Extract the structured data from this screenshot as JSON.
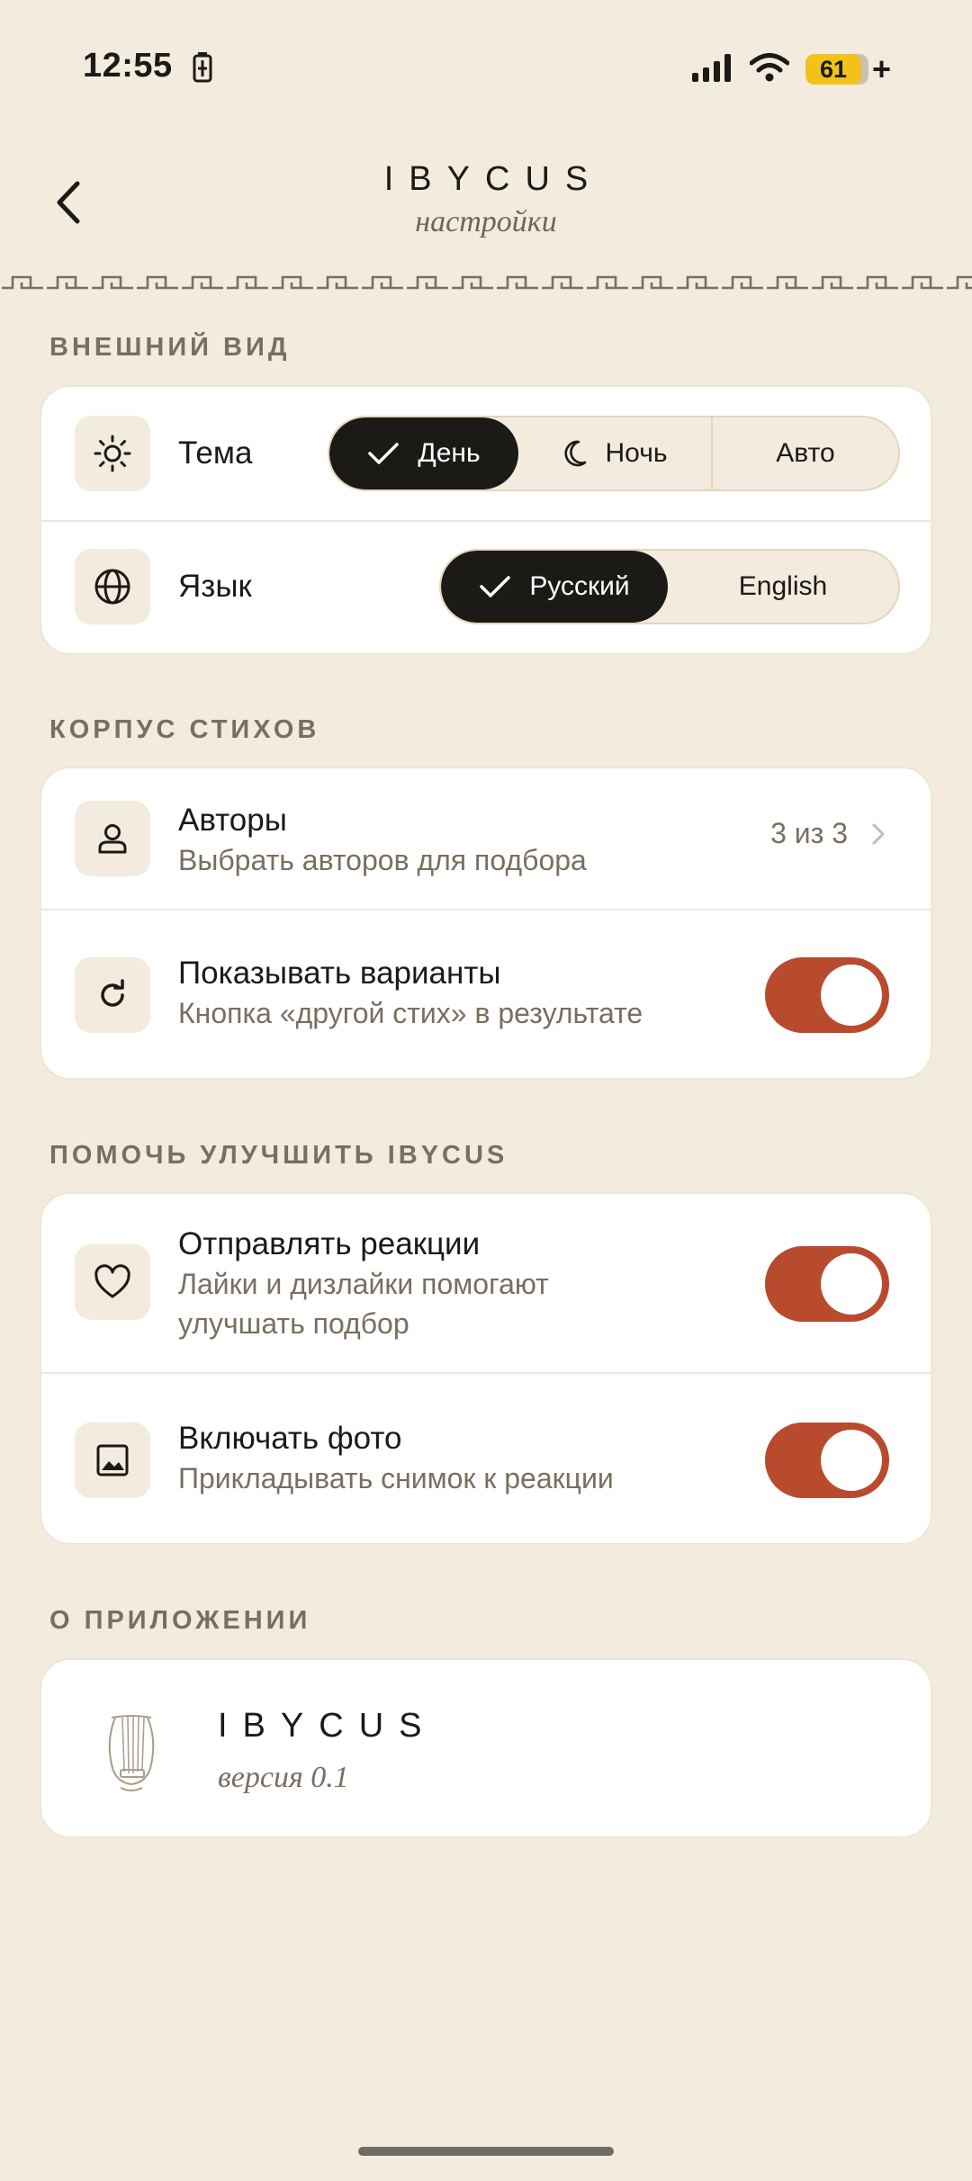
{
  "status_bar": {
    "time": "12:55",
    "battery": "61",
    "battery_suffix": "+"
  },
  "header": {
    "title": "IBYCUS",
    "subtitle": "настройки"
  },
  "sections": {
    "appearance": {
      "label": "ВНЕШНИЙ ВИД",
      "theme": {
        "label": "Тема",
        "options": [
          "День",
          "Ночь",
          "Авто"
        ],
        "selected": "День"
      },
      "language": {
        "label": "Язык",
        "options": [
          "Русский",
          "English"
        ],
        "selected": "Русский"
      }
    },
    "corpus": {
      "label": "КОРПУС СТИХОВ",
      "authors": {
        "title": "Авторы",
        "subtitle": "Выбрать авторов для подбора",
        "count": "3 из 3"
      },
      "variants": {
        "title": "Показывать варианты",
        "subtitle": "Кнопка «другой стих» в результате",
        "enabled": true
      }
    },
    "improve": {
      "label": "ПОМОЧЬ УЛУЧШИТЬ IBYCUS",
      "reactions": {
        "title": "Отправлять реакции",
        "subtitle_line1": "Лайки и дизлайки помогают",
        "subtitle_line2": "улучшать подбор",
        "enabled": true
      },
      "photo": {
        "title": "Включать фото",
        "subtitle": "Прикладывать снимок к реакции",
        "enabled": true
      }
    },
    "about": {
      "label": "О ПРИЛОЖЕНИИ",
      "app_name": "IBYCUS",
      "version": "версия 0.1"
    }
  },
  "colors": {
    "background": "#F3EBDD",
    "accent": "#B84A2E",
    "ink": "#1C1A17",
    "muted": "#7A6E60",
    "battery": "#F2C21B"
  }
}
